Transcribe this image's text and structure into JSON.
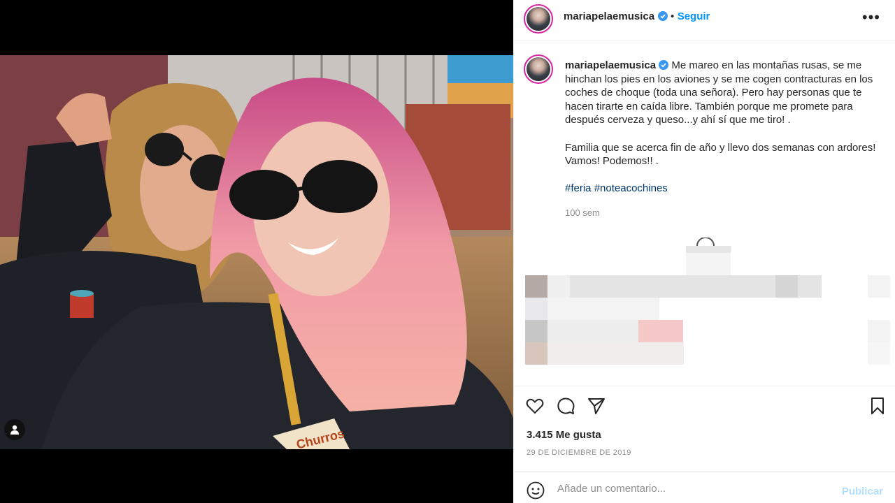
{
  "post": {
    "username": "mariapelaemusica",
    "follow_label": "Seguir",
    "dot": "•",
    "more": "•••",
    "caption_para1": "Me mareo en las montañas rusas, se me hinchan los pies en los aviones y se me cogen contracturas en los coches de choque (toda una señora). Pero hay personas que te hacen tirarte en caída libre. También porque me promete para después cerveza y queso...y ahí sí que me tiro! .",
    "caption_para2": "Familia que se acerca fin de año y llevo dos semanas con ardores! Vamos! Podemos!! .",
    "hashtags": [
      "#feria",
      "#noteacochines"
    ],
    "time_ago": "100 sem",
    "likes": "3.415 Me gusta",
    "date": "29 de diciembre de 2019",
    "photo_sign": "Churros"
  },
  "comment": {
    "placeholder": "Añade un comentario...",
    "publish_label": "Publicar"
  },
  "colors": {
    "link_blue": "#0095f6",
    "hashtag": "#00376b",
    "muted": "#8e8e8e",
    "publish_disabled": "#b2dffc"
  },
  "icons": [
    "user-tag-icon",
    "verified-badge-icon",
    "more-options-icon",
    "heart-icon",
    "comment-icon",
    "share-icon",
    "bookmark-icon",
    "emoji-icon",
    "info-icon"
  ]
}
